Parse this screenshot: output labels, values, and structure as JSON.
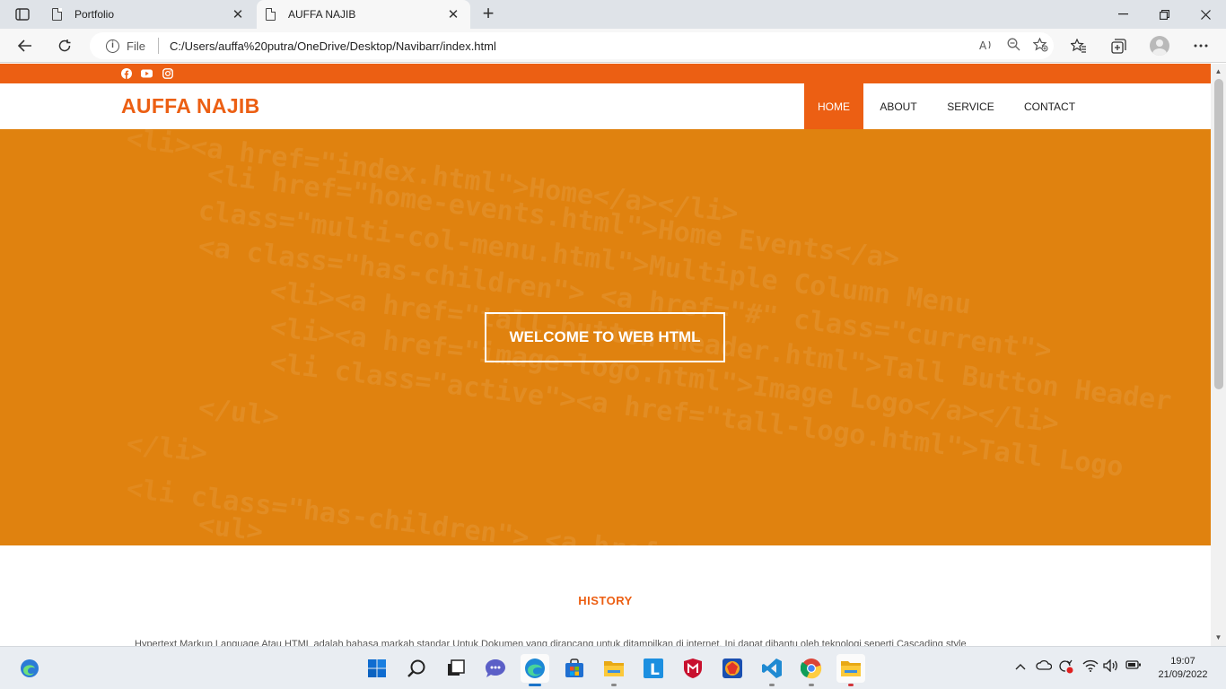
{
  "browser": {
    "tabs": [
      {
        "title": "Portfolio"
      },
      {
        "title": "AUFFA NAJIB"
      }
    ],
    "address": {
      "scheme_label": "File",
      "url": "C:/Users/auffa%20putra/OneDrive/Desktop/Navibarr/index.html"
    },
    "window_controls": {
      "minimize": "—",
      "restore": "❐",
      "close": "✕"
    }
  },
  "site": {
    "social_icons": [
      "facebook-icon",
      "youtube-icon",
      "instagram-icon"
    ],
    "brand": "AUFFA NAJIB",
    "menu": [
      {
        "label": "HOME",
        "active": true
      },
      {
        "label": "ABOUT",
        "active": false
      },
      {
        "label": "SERVICE",
        "active": false
      },
      {
        "label": "CONTACT",
        "active": false
      }
    ],
    "hero": {
      "heading": "WELCOME TO WEB HTML"
    },
    "history": {
      "title": "HISTORY",
      "text": "Hypertext Markup Language Atau HTML adalah bahasa markah standar Untuk Dokumen yang dirancang untuk ditampilkan di internet. Ini dapat dibantu oleh teknologi seperti Cascading style"
    },
    "colors": {
      "accent": "#ec5f13",
      "hero_bg": "#e0820f"
    }
  },
  "taskbar": {
    "apps": [
      "edge-widget-icon",
      "windows-start-icon",
      "search-icon",
      "task-view-icon",
      "teams-chat-icon",
      "edge-icon",
      "store-icon",
      "file-explorer-icon",
      "l-app-icon",
      "mcafee-icon",
      "game-icon",
      "vscode-icon",
      "chrome-icon",
      "file-explorer-2-icon"
    ],
    "time": "19:07",
    "date": "21/09/2022"
  }
}
